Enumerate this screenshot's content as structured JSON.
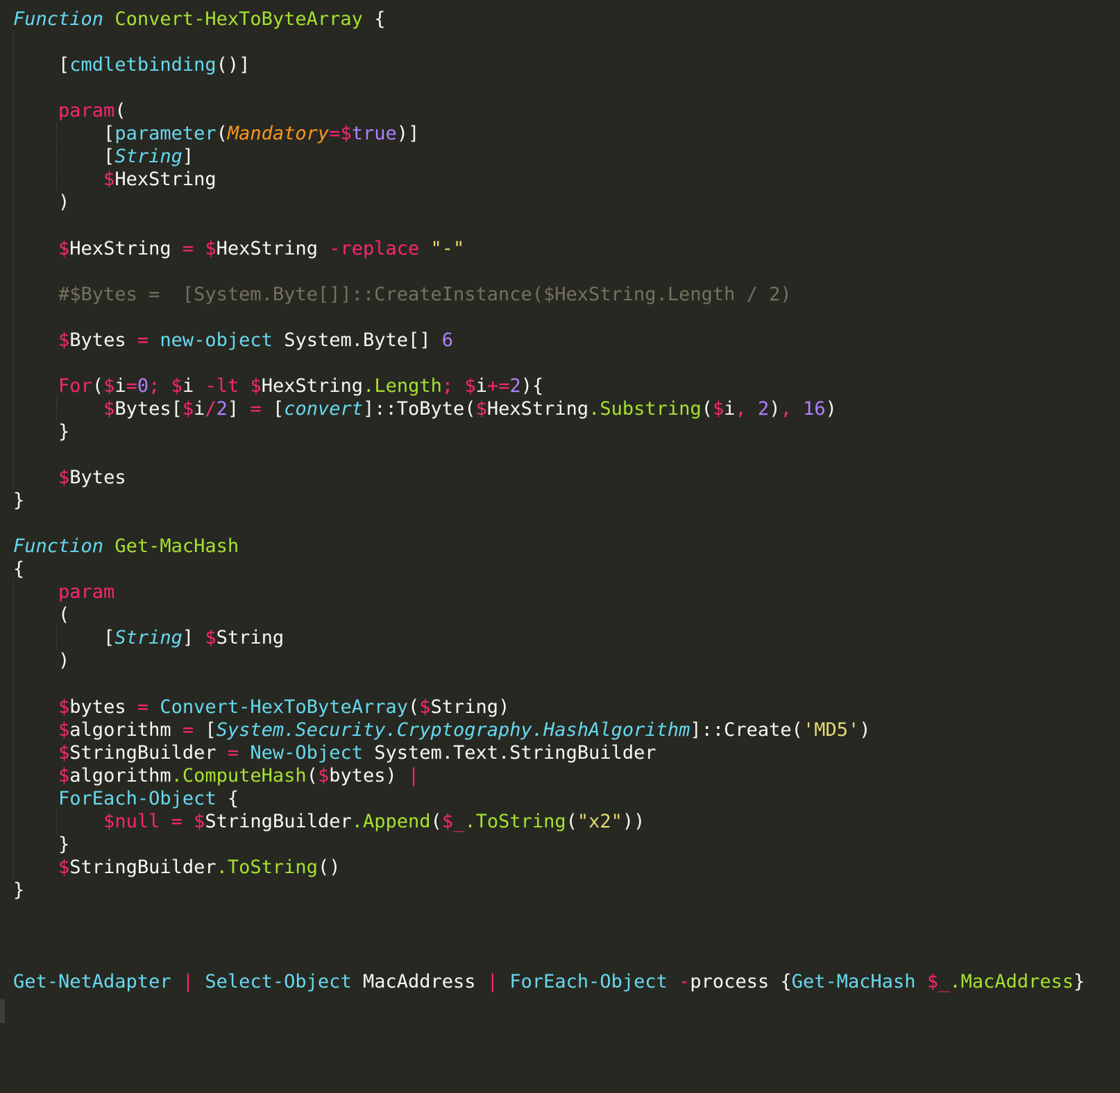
{
  "code": {
    "lines": [
      {
        "tokens": [
          {
            "t": "Function",
            "c": "c-cyan-i"
          },
          {
            "t": " ",
            "c": "c-plain"
          },
          {
            "t": "Convert-HexToByteArray",
            "c": "c-green"
          },
          {
            "t": " {",
            "c": "c-plain"
          }
        ]
      },
      {
        "tokens": []
      },
      {
        "tokens": [
          {
            "t": "    [",
            "c": "c-plain"
          },
          {
            "t": "cmdletbinding",
            "c": "c-cyan"
          },
          {
            "t": "()]",
            "c": "c-plain"
          }
        ]
      },
      {
        "tokens": []
      },
      {
        "tokens": [
          {
            "t": "    ",
            "c": "c-plain"
          },
          {
            "t": "param",
            "c": "c-pink"
          },
          {
            "t": "(",
            "c": "c-plain"
          }
        ]
      },
      {
        "tokens": [
          {
            "t": "        [",
            "c": "c-plain"
          },
          {
            "t": "parameter",
            "c": "c-cyan"
          },
          {
            "t": "(",
            "c": "c-plain"
          },
          {
            "t": "Mandatory",
            "c": "c-orange-i"
          },
          {
            "t": "=",
            "c": "c-pink"
          },
          {
            "t": "$",
            "c": "c-pink"
          },
          {
            "t": "true",
            "c": "c-purple"
          },
          {
            "t": ")]",
            "c": "c-plain"
          }
        ]
      },
      {
        "tokens": [
          {
            "t": "        [",
            "c": "c-plain"
          },
          {
            "t": "String",
            "c": "c-cyan-i"
          },
          {
            "t": "]",
            "c": "c-plain"
          }
        ]
      },
      {
        "tokens": [
          {
            "t": "        ",
            "c": "c-plain"
          },
          {
            "t": "$",
            "c": "c-pink"
          },
          {
            "t": "HexString",
            "c": "c-plain"
          }
        ]
      },
      {
        "tokens": [
          {
            "t": "    )",
            "c": "c-plain"
          }
        ]
      },
      {
        "tokens": []
      },
      {
        "tokens": [
          {
            "t": "    ",
            "c": "c-plain"
          },
          {
            "t": "$",
            "c": "c-pink"
          },
          {
            "t": "HexString ",
            "c": "c-plain"
          },
          {
            "t": "=",
            "c": "c-pink"
          },
          {
            "t": " ",
            "c": "c-plain"
          },
          {
            "t": "$",
            "c": "c-pink"
          },
          {
            "t": "HexString ",
            "c": "c-plain"
          },
          {
            "t": "-replace",
            "c": "c-pink"
          },
          {
            "t": " ",
            "c": "c-plain"
          },
          {
            "t": "\"-\"",
            "c": "c-yellow"
          }
        ]
      },
      {
        "tokens": []
      },
      {
        "tokens": [
          {
            "t": "    ",
            "c": "c-plain"
          },
          {
            "t": "#$Bytes =  [System.Byte[]]::CreateInstance($HexString.Length / 2)",
            "c": "c-comment"
          }
        ]
      },
      {
        "tokens": []
      },
      {
        "tokens": [
          {
            "t": "    ",
            "c": "c-plain"
          },
          {
            "t": "$",
            "c": "c-pink"
          },
          {
            "t": "Bytes ",
            "c": "c-plain"
          },
          {
            "t": "=",
            "c": "c-pink"
          },
          {
            "t": " ",
            "c": "c-plain"
          },
          {
            "t": "new-object",
            "c": "c-cyan"
          },
          {
            "t": " System.Byte[] ",
            "c": "c-plain"
          },
          {
            "t": "6",
            "c": "c-purple"
          }
        ]
      },
      {
        "tokens": []
      },
      {
        "tokens": [
          {
            "t": "    ",
            "c": "c-plain"
          },
          {
            "t": "For",
            "c": "c-pink"
          },
          {
            "t": "(",
            "c": "c-plain"
          },
          {
            "t": "$",
            "c": "c-pink"
          },
          {
            "t": "i",
            "c": "c-plain"
          },
          {
            "t": "=",
            "c": "c-pink"
          },
          {
            "t": "0",
            "c": "c-purple"
          },
          {
            "t": ";",
            "c": "c-pink"
          },
          {
            "t": " ",
            "c": "c-plain"
          },
          {
            "t": "$",
            "c": "c-pink"
          },
          {
            "t": "i ",
            "c": "c-plain"
          },
          {
            "t": "-lt",
            "c": "c-pink"
          },
          {
            "t": " ",
            "c": "c-plain"
          },
          {
            "t": "$",
            "c": "c-pink"
          },
          {
            "t": "HexString",
            "c": "c-plain"
          },
          {
            "t": ".Length",
            "c": "c-green"
          },
          {
            "t": ";",
            "c": "c-pink"
          },
          {
            "t": " ",
            "c": "c-plain"
          },
          {
            "t": "$",
            "c": "c-pink"
          },
          {
            "t": "i",
            "c": "c-plain"
          },
          {
            "t": "+=",
            "c": "c-pink"
          },
          {
            "t": "2",
            "c": "c-purple"
          },
          {
            "t": "){",
            "c": "c-plain"
          }
        ]
      },
      {
        "tokens": [
          {
            "t": "        ",
            "c": "c-plain"
          },
          {
            "t": "$",
            "c": "c-pink"
          },
          {
            "t": "Bytes[",
            "c": "c-plain"
          },
          {
            "t": "$",
            "c": "c-pink"
          },
          {
            "t": "i",
            "c": "c-plain"
          },
          {
            "t": "/",
            "c": "c-pink"
          },
          {
            "t": "2",
            "c": "c-purple"
          },
          {
            "t": "] ",
            "c": "c-plain"
          },
          {
            "t": "=",
            "c": "c-pink"
          },
          {
            "t": " [",
            "c": "c-plain"
          },
          {
            "t": "convert",
            "c": "c-cyan-i"
          },
          {
            "t": "]::ToByte(",
            "c": "c-plain"
          },
          {
            "t": "$",
            "c": "c-pink"
          },
          {
            "t": "HexString",
            "c": "c-plain"
          },
          {
            "t": ".Substring",
            "c": "c-green"
          },
          {
            "t": "(",
            "c": "c-plain"
          },
          {
            "t": "$",
            "c": "c-pink"
          },
          {
            "t": "i",
            "c": "c-plain"
          },
          {
            "t": ",",
            "c": "c-pink"
          },
          {
            "t": " ",
            "c": "c-plain"
          },
          {
            "t": "2",
            "c": "c-purple"
          },
          {
            "t": ")",
            "c": "c-plain"
          },
          {
            "t": ",",
            "c": "c-pink"
          },
          {
            "t": " ",
            "c": "c-plain"
          },
          {
            "t": "16",
            "c": "c-purple"
          },
          {
            "t": ")",
            "c": "c-plain"
          }
        ]
      },
      {
        "tokens": [
          {
            "t": "    }",
            "c": "c-plain"
          }
        ]
      },
      {
        "tokens": []
      },
      {
        "tokens": [
          {
            "t": "    ",
            "c": "c-plain"
          },
          {
            "t": "$",
            "c": "c-pink"
          },
          {
            "t": "Bytes",
            "c": "c-plain"
          }
        ]
      },
      {
        "tokens": [
          {
            "t": "}",
            "c": "c-plain"
          }
        ]
      },
      {
        "tokens": []
      },
      {
        "tokens": [
          {
            "t": "Function",
            "c": "c-cyan-i"
          },
          {
            "t": " ",
            "c": "c-plain"
          },
          {
            "t": "Get-MacHash",
            "c": "c-green"
          }
        ]
      },
      {
        "tokens": [
          {
            "t": "{",
            "c": "c-plain"
          }
        ]
      },
      {
        "tokens": [
          {
            "t": "    ",
            "c": "c-plain"
          },
          {
            "t": "param",
            "c": "c-pink"
          }
        ]
      },
      {
        "tokens": [
          {
            "t": "    (",
            "c": "c-plain"
          }
        ]
      },
      {
        "tokens": [
          {
            "t": "        [",
            "c": "c-plain"
          },
          {
            "t": "String",
            "c": "c-cyan-i"
          },
          {
            "t": "] ",
            "c": "c-plain"
          },
          {
            "t": "$",
            "c": "c-pink"
          },
          {
            "t": "String",
            "c": "c-plain"
          }
        ]
      },
      {
        "tokens": [
          {
            "t": "    )",
            "c": "c-plain"
          }
        ]
      },
      {
        "tokens": []
      },
      {
        "tokens": [
          {
            "t": "    ",
            "c": "c-plain"
          },
          {
            "t": "$",
            "c": "c-pink"
          },
          {
            "t": "bytes ",
            "c": "c-plain"
          },
          {
            "t": "=",
            "c": "c-pink"
          },
          {
            "t": " ",
            "c": "c-plain"
          },
          {
            "t": "Convert-HexToByteArray",
            "c": "c-cyan"
          },
          {
            "t": "(",
            "c": "c-plain"
          },
          {
            "t": "$",
            "c": "c-pink"
          },
          {
            "t": "String)",
            "c": "c-plain"
          }
        ]
      },
      {
        "tokens": [
          {
            "t": "    ",
            "c": "c-plain"
          },
          {
            "t": "$",
            "c": "c-pink"
          },
          {
            "t": "algorithm ",
            "c": "c-plain"
          },
          {
            "t": "=",
            "c": "c-pink"
          },
          {
            "t": " [",
            "c": "c-plain"
          },
          {
            "t": "System.Security.Cryptography.HashAlgorithm",
            "c": "c-cyan-i"
          },
          {
            "t": "]::Create(",
            "c": "c-plain"
          },
          {
            "t": "'MD5'",
            "c": "c-yellow"
          },
          {
            "t": ")",
            "c": "c-plain"
          }
        ]
      },
      {
        "tokens": [
          {
            "t": "    ",
            "c": "c-plain"
          },
          {
            "t": "$",
            "c": "c-pink"
          },
          {
            "t": "StringBuilder ",
            "c": "c-plain"
          },
          {
            "t": "=",
            "c": "c-pink"
          },
          {
            "t": " ",
            "c": "c-plain"
          },
          {
            "t": "New-Object",
            "c": "c-cyan"
          },
          {
            "t": " System.Text.StringBuilder",
            "c": "c-plain"
          }
        ]
      },
      {
        "tokens": [
          {
            "t": "    ",
            "c": "c-plain"
          },
          {
            "t": "$",
            "c": "c-pink"
          },
          {
            "t": "algorithm",
            "c": "c-plain"
          },
          {
            "t": ".ComputeHash",
            "c": "c-green"
          },
          {
            "t": "(",
            "c": "c-plain"
          },
          {
            "t": "$",
            "c": "c-pink"
          },
          {
            "t": "bytes) ",
            "c": "c-plain"
          },
          {
            "t": "|",
            "c": "c-pink"
          }
        ]
      },
      {
        "tokens": [
          {
            "t": "    ",
            "c": "c-plain"
          },
          {
            "t": "ForEach-Object",
            "c": "c-cyan"
          },
          {
            "t": " {",
            "c": "c-plain"
          }
        ]
      },
      {
        "tokens": [
          {
            "t": "        ",
            "c": "c-plain"
          },
          {
            "t": "$",
            "c": "c-pink"
          },
          {
            "t": "null",
            "c": "c-pink"
          },
          {
            "t": " ",
            "c": "c-plain"
          },
          {
            "t": "=",
            "c": "c-pink"
          },
          {
            "t": " ",
            "c": "c-plain"
          },
          {
            "t": "$",
            "c": "c-pink"
          },
          {
            "t": "StringBuilder",
            "c": "c-plain"
          },
          {
            "t": ".Append",
            "c": "c-green"
          },
          {
            "t": "(",
            "c": "c-plain"
          },
          {
            "t": "$_",
            "c": "c-pink"
          },
          {
            "t": ".ToString",
            "c": "c-green"
          },
          {
            "t": "(",
            "c": "c-plain"
          },
          {
            "t": "\"x2\"",
            "c": "c-yellow"
          },
          {
            "t": "))",
            "c": "c-plain"
          }
        ]
      },
      {
        "tokens": [
          {
            "t": "    }",
            "c": "c-plain"
          }
        ]
      },
      {
        "tokens": [
          {
            "t": "    ",
            "c": "c-plain"
          },
          {
            "t": "$",
            "c": "c-pink"
          },
          {
            "t": "StringBuilder",
            "c": "c-plain"
          },
          {
            "t": ".ToString",
            "c": "c-green"
          },
          {
            "t": "()",
            "c": "c-plain"
          }
        ]
      },
      {
        "tokens": [
          {
            "t": "}",
            "c": "c-plain"
          }
        ]
      },
      {
        "tokens": []
      },
      {
        "tokens": []
      },
      {
        "tokens": []
      },
      {
        "tokens": [
          {
            "t": "Get-NetAdapter",
            "c": "c-cyan"
          },
          {
            "t": " ",
            "c": "c-plain"
          },
          {
            "t": "|",
            "c": "c-pink"
          },
          {
            "t": " ",
            "c": "c-plain"
          },
          {
            "t": "Select-Object",
            "c": "c-cyan"
          },
          {
            "t": " MacAddress ",
            "c": "c-plain"
          },
          {
            "t": "|",
            "c": "c-pink"
          },
          {
            "t": " ",
            "c": "c-plain"
          },
          {
            "t": "ForEach-Object",
            "c": "c-cyan"
          },
          {
            "t": " ",
            "c": "c-plain"
          },
          {
            "t": "-",
            "c": "c-pink"
          },
          {
            "t": "process {",
            "c": "c-plain"
          },
          {
            "t": "Get-MacHash",
            "c": "c-cyan"
          },
          {
            "t": " ",
            "c": "c-plain"
          },
          {
            "t": "$_",
            "c": "c-pink"
          },
          {
            "t": ".MacAddress",
            "c": "c-green"
          },
          {
            "t": "}",
            "c": "c-plain"
          }
        ]
      }
    ]
  }
}
